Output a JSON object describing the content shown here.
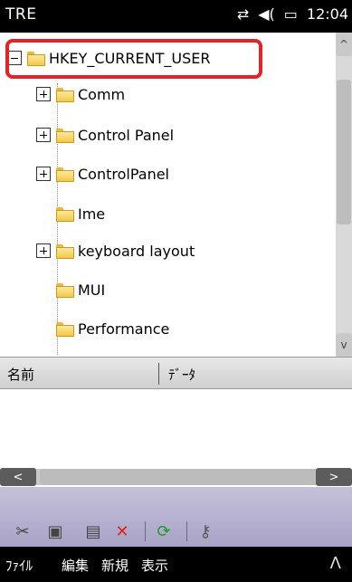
{
  "statusbar": {
    "title": "TRE",
    "icons": [
      "connectivity-icon",
      "volume-icon",
      "battery-icon"
    ],
    "connectivity_glyph": "⇄",
    "volume_glyph": "◀(",
    "battery_glyph": "▭",
    "time": "12:04"
  },
  "tree": {
    "root": {
      "label": "HKEY_CURRENT_USER",
      "expanded": true,
      "highlighted": true
    },
    "children": [
      {
        "label": "Comm",
        "has_children": true
      },
      {
        "label": "Control Panel",
        "has_children": true
      },
      {
        "label": "ControlPanel",
        "has_children": true
      },
      {
        "label": "Ime",
        "has_children": false
      },
      {
        "label": "keyboard layout",
        "has_children": true
      },
      {
        "label": "MUI",
        "has_children": false
      },
      {
        "label": "Performance",
        "has_children": false
      }
    ],
    "highlight_color": "#e2232a"
  },
  "list": {
    "columns": [
      "名前",
      "ﾃﾞｰﾀ"
    ]
  },
  "hscroll": {
    "left_glyph": "<",
    "right_glyph": ">"
  },
  "vscroll": {
    "up_glyph": "^",
    "down_glyph": "v"
  },
  "toolbar": {
    "buttons": [
      {
        "icon": "cut-icon",
        "glyph": "✂"
      },
      {
        "icon": "copy-icon",
        "glyph": "▣"
      },
      {
        "icon": "paste-icon",
        "glyph": "▤"
      },
      {
        "icon": "delete-icon",
        "glyph": "✕"
      },
      {
        "icon": "refresh-icon",
        "glyph": "⟳"
      },
      {
        "icon": "key-icon",
        "glyph": "⚷"
      }
    ],
    "background": "#b6b2d0"
  },
  "menubar": {
    "items": [
      "ﾌｧｲﾙ",
      "編集",
      "新規",
      "表示"
    ],
    "expand_glyph": "Λ"
  }
}
